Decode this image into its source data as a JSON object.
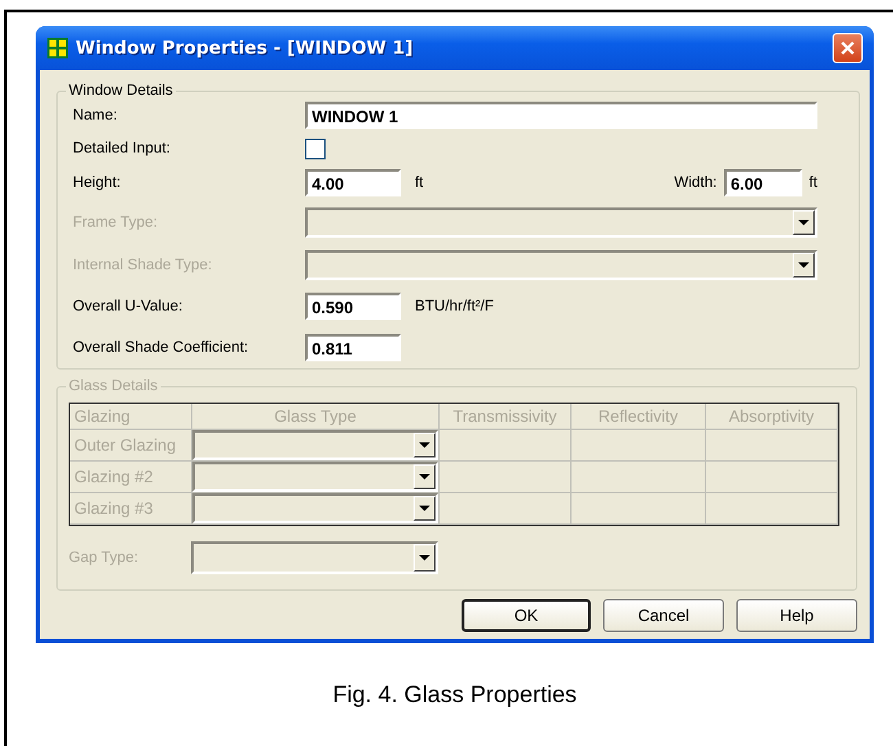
{
  "window": {
    "title": "Window Properties - [WINDOW 1]"
  },
  "window_details": {
    "label": "Window Details",
    "fields": [
      {
        "kind": "text",
        "label": "Name:",
        "value": "WINDOW 1",
        "disabled": false
      },
      {
        "kind": "checkbox",
        "label": "Detailed Input:",
        "checked": false,
        "disabled": false
      },
      {
        "kind": "pair",
        "label": "Height:",
        "value": "4.00",
        "unit": "ft",
        "label_2": "Width:",
        "value_2": "6.00",
        "unit_2": "ft",
        "disabled": false
      },
      {
        "kind": "combo",
        "label": "Frame Type:",
        "disabled": true
      },
      {
        "kind": "combo",
        "label": "Internal Shade Type:",
        "disabled": true
      },
      {
        "kind": "number",
        "label": "Overall U-Value:",
        "value": "0.590",
        "unit": "BTU/hr/ft²/F",
        "disabled": false
      },
      {
        "kind": "number",
        "label": "Overall Shade Coefficient:",
        "value": "0.811",
        "disabled": false
      }
    ]
  },
  "glass_details": {
    "label": "Glass Details",
    "disabled": true,
    "columns": [
      "Glazing",
      "Glass Type",
      "Transmissivity",
      "Reflectivity",
      "Absorptivity"
    ],
    "rows": [
      {
        "glazing": "Outer Glazing"
      },
      {
        "glazing": "Glazing #2"
      },
      {
        "glazing": "Glazing #3"
      }
    ],
    "gap_type": {
      "label": "Gap Type:"
    }
  },
  "buttons": [
    {
      "label": "OK",
      "default": true
    },
    {
      "label": "Cancel",
      "default": false
    },
    {
      "label": "Help",
      "default": false
    }
  ],
  "caption": "Fig. 4. Glass Properties"
}
